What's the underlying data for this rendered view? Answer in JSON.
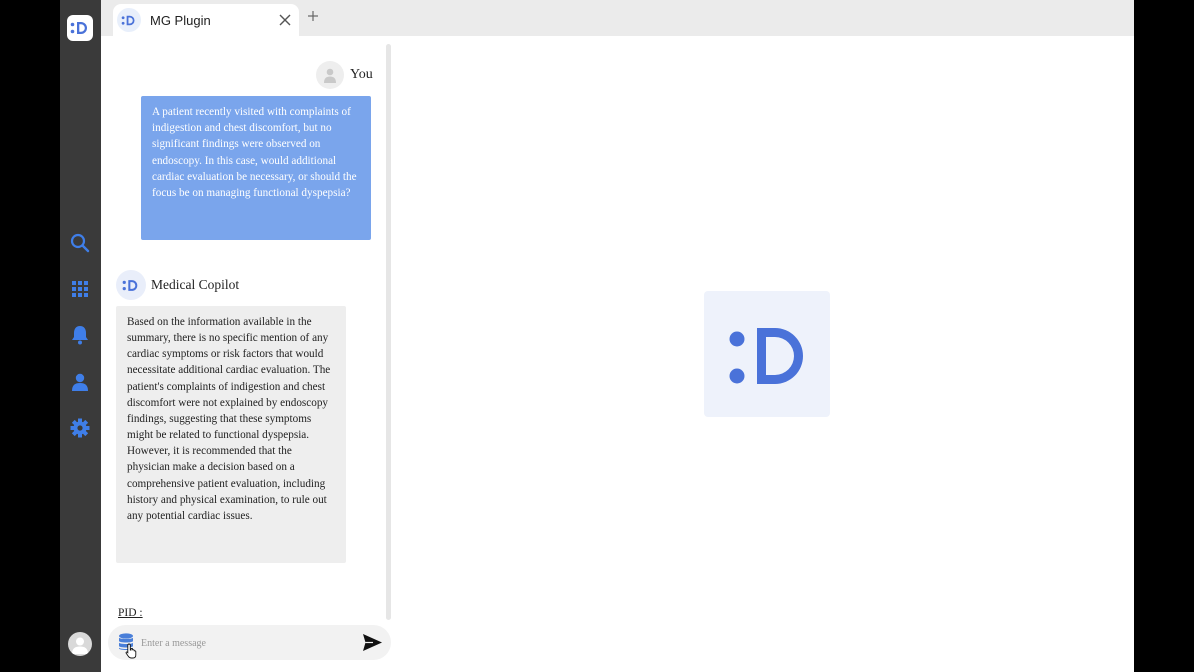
{
  "tab": {
    "title": "MG Plugin"
  },
  "chat": {
    "user_name": "You",
    "user_message": "A patient recently visited with complaints of indigestion and chest discomfort, but no significant findings were observed on endoscopy. In this case, would additional cardiac evaluation be necessary, or should the focus be on managing functional dyspepsia?",
    "bot_name": "Medical Copilot",
    "bot_message": "Based on the information available in the summary, there is no specific mention of any cardiac symptoms or risk factors that would necessitate additional cardiac evaluation. The patient's complaints of indigestion and chest discomfort were not explained by endoscopy findings, suggesting that these symptoms might be related to functional dyspepsia. However, it is recommended that the physician make a decision based on a comprehensive patient evaluation, including history and physical examination, to rule out any potential cardiac issues.",
    "pid_label": "PID :"
  },
  "composer": {
    "placeholder": "Enter a message"
  },
  "colors": {
    "brand": "#4a72d9",
    "user_bubble": "#7aa5ec",
    "rail": "#3a3a3a",
    "rail_icon": "#3f7ee8"
  },
  "icons": {
    "rail": [
      "search-icon",
      "apps-grid-icon",
      "bell-icon",
      "user-icon",
      "gear-icon"
    ]
  }
}
